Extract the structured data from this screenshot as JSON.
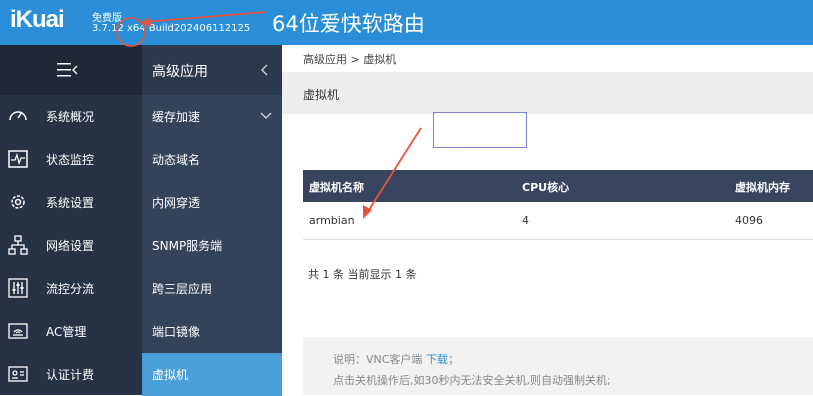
{
  "header": {
    "logo": "iKuai",
    "edition": "免费版",
    "version": "3.7.12 x64 Build202406112125",
    "annotation": "64位爱快软路由",
    "bg_color": "#2a8fd8"
  },
  "sidebar": {
    "toggle_icon": "menu-collapse-icon",
    "items": [
      {
        "label": "系统概况",
        "icon": "dashboard-icon"
      },
      {
        "label": "状态监控",
        "icon": "monitor-icon"
      },
      {
        "label": "系统设置",
        "icon": "gear-icon"
      },
      {
        "label": "网络设置",
        "icon": "network-icon"
      },
      {
        "label": "流控分流",
        "icon": "sliders-icon"
      },
      {
        "label": "AC管理",
        "icon": "router-icon"
      },
      {
        "label": "认证计费",
        "icon": "id-card-icon"
      }
    ]
  },
  "subbar": {
    "title": "高级应用",
    "items": [
      {
        "label": "缓存加速"
      },
      {
        "label": "动态域名"
      },
      {
        "label": "内网穿透"
      },
      {
        "label": "SNMP服务端"
      },
      {
        "label": "跨三层应用"
      },
      {
        "label": "端口镜像"
      },
      {
        "label": "虚拟机"
      }
    ],
    "active_color": "#4b9fd9"
  },
  "main": {
    "breadcrumb": "高级应用 > 虚拟机",
    "page_title": "虚拟机",
    "table": {
      "headers": [
        "虚拟机名称",
        "CPU核心",
        "虚拟机内存"
      ],
      "rows": [
        [
          "armbian",
          "4",
          "4096"
        ]
      ]
    },
    "pager": "共 1 条 当前显示 1 条",
    "note_prefix": "说明：VNC客户端 ",
    "note_link": "下载",
    "note_suffix": "；",
    "note_line2": "点击关机操作后,如30秒内无法安全关机,则自动强制关机;"
  },
  "annotation_color": "#e8543a"
}
